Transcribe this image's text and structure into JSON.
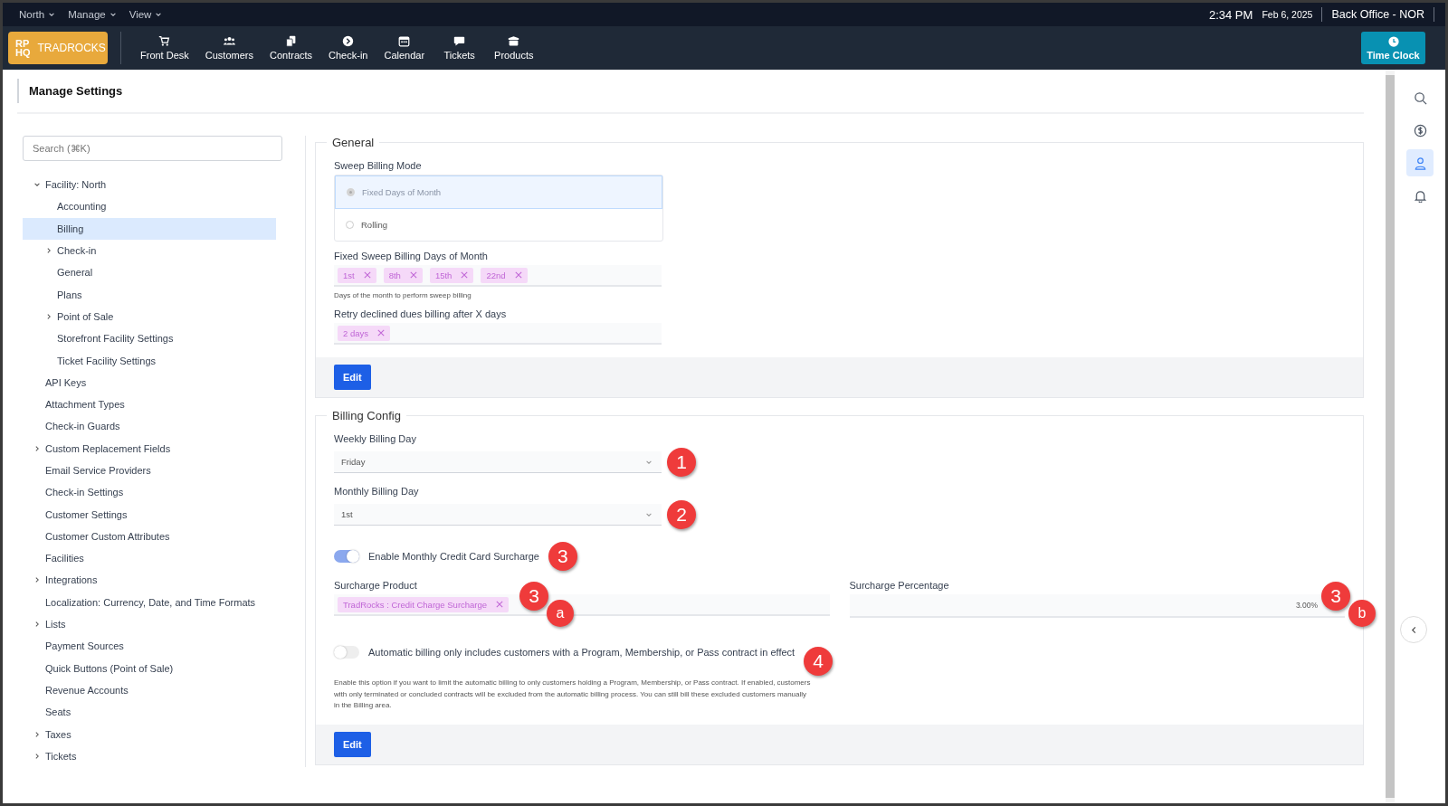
{
  "top_menu": [
    {
      "label": "North"
    },
    {
      "label": "Manage"
    },
    {
      "label": "View"
    }
  ],
  "clock": {
    "time": "2:34 PM",
    "date": "Feb 6, 2025",
    "location": "Back Office - NOR"
  },
  "logo": {
    "mark_top": "RP",
    "mark_bottom": "HQ",
    "name": "TRADROCKS"
  },
  "nav": [
    {
      "label": "Front Desk"
    },
    {
      "label": "Customers"
    },
    {
      "label": "Contracts"
    },
    {
      "label": "Check-in"
    },
    {
      "label": "Calendar"
    },
    {
      "label": "Tickets"
    },
    {
      "label": "Products"
    }
  ],
  "time_clock": {
    "label": "Time Clock"
  },
  "page_title": "Manage Settings",
  "sidebar": {
    "search": {
      "placeholder": "Search (⌘K)"
    },
    "items": [
      {
        "label": "Facility: North",
        "selected": false,
        "expanded": true,
        "children": [
          {
            "label": "Accounting",
            "selected": false
          },
          {
            "label": "Billing",
            "selected": true
          },
          {
            "label": "Check-in",
            "selected": false,
            "expanded": false
          },
          {
            "label": "General",
            "selected": false
          },
          {
            "label": "Plans",
            "selected": false
          },
          {
            "label": "Point of Sale",
            "selected": false,
            "expanded": false
          },
          {
            "label": "Storefront Facility Settings",
            "selected": false
          },
          {
            "label": "Ticket Facility Settings",
            "selected": false
          }
        ]
      },
      {
        "label": "API Keys",
        "selected": false
      },
      {
        "label": "Attachment Types",
        "selected": false
      },
      {
        "label": "Check-in Guards",
        "selected": false
      },
      {
        "label": "Custom Replacement Fields",
        "selected": false,
        "expanded": false
      },
      {
        "label": "Email Service Providers",
        "selected": false
      },
      {
        "label": "Check-in Settings",
        "selected": false
      },
      {
        "label": "Customer Settings",
        "selected": false
      },
      {
        "label": "Customer Custom Attributes",
        "selected": false
      },
      {
        "label": "Facilities",
        "selected": false
      },
      {
        "label": "Integrations",
        "selected": false,
        "expanded": false
      },
      {
        "label": "Localization: Currency, Date, and Time Formats",
        "selected": false
      },
      {
        "label": "Lists",
        "selected": false,
        "expanded": false
      },
      {
        "label": "Payment Sources",
        "selected": false
      },
      {
        "label": "Quick Buttons (Point of Sale)",
        "selected": false
      },
      {
        "label": "Revenue Accounts",
        "selected": false
      },
      {
        "label": "Seats",
        "selected": false
      },
      {
        "label": "Taxes",
        "selected": false,
        "expanded": false
      },
      {
        "label": "Tickets",
        "selected": false,
        "expanded": false
      }
    ]
  },
  "general": {
    "title": "General",
    "sweep_mode": {
      "label": "Sweep Billing Mode",
      "options": [
        {
          "label": "Fixed Days of Month",
          "selected": true
        },
        {
          "label": "Rolling",
          "selected": false
        }
      ]
    },
    "fixed_days": {
      "label": "Fixed Sweep Billing Days of Month",
      "tags": [
        "1st",
        "8th",
        "15th",
        "22nd"
      ],
      "help": "Days of the month to perform sweep billing"
    },
    "retry": {
      "label": "Retry declined dues billing after X days",
      "tags": [
        "2 days"
      ]
    },
    "edit": "Edit"
  },
  "billing_config": {
    "title": "Billing Config",
    "weekly": {
      "label": "Weekly Billing Day",
      "value": "Friday",
      "callout": "1"
    },
    "monthly": {
      "label": "Monthly Billing Day",
      "value": "1st",
      "callout": "2"
    },
    "surcharge_toggle": {
      "label": "Enable Monthly Credit Card Surcharge",
      "on": true,
      "callout": "3"
    },
    "surcharge_product": {
      "label": "Surcharge Product",
      "tags": [
        "TradRocks : Credit Charge Surcharge"
      ],
      "callout": "3",
      "callout_sub": "a"
    },
    "surcharge_percentage": {
      "label": "Surcharge Percentage",
      "value": "3.00%",
      "callout": "3",
      "callout_sub": "b"
    },
    "contract_toggle": {
      "label": "Automatic billing only includes customers with a Program, Membership, or Pass contract in effect",
      "on": false,
      "callout": "4",
      "help": "Enable this option if you want to limit the automatic billing to only customers holding a Program, Membership, or Pass contract. If enabled, customers with only terminated or concluded contracts will be excluded from the automatic billing process. You can still bill these excluded customers manually in the Billing area."
    },
    "edit": "Edit"
  },
  "right_rail": [
    {
      "selected": false
    },
    {
      "selected": false
    },
    {
      "selected": true
    },
    {
      "selected": false
    }
  ]
}
